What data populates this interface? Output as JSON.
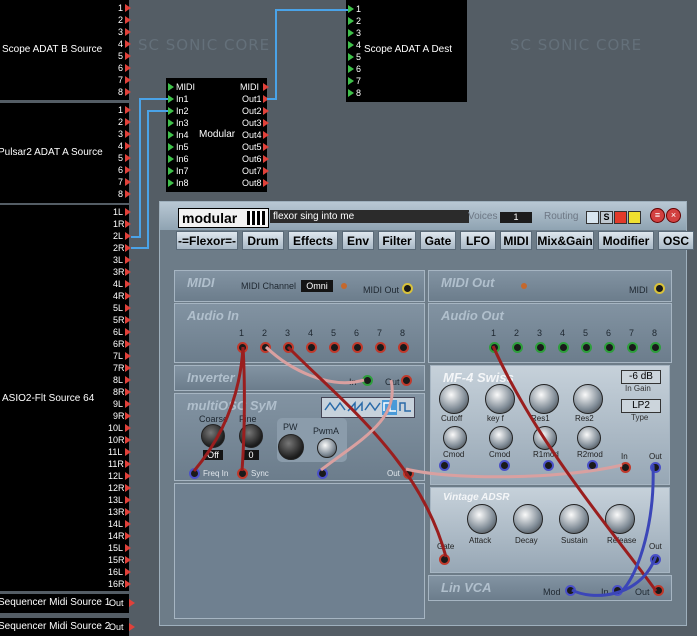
{
  "watermarks": [
    "SC SONIC CORE",
    "SC SONIC CORE"
  ],
  "nodes": {
    "adat_b_source": {
      "name": "Scope ADAT B Source",
      "ports": [
        "1",
        "2",
        "3",
        "4",
        "5",
        "6",
        "7",
        "8"
      ]
    },
    "pulsar_adat_a_source": {
      "name": "Pulsar2 ADAT A Source",
      "ports": [
        "1",
        "2",
        "3",
        "4",
        "5",
        "6",
        "7",
        "8"
      ]
    },
    "asio_source": {
      "name": "ASIO2-Flt Source 64",
      "ports": [
        "1L",
        "1R",
        "2L",
        "2R",
        "3L",
        "3R",
        "4L",
        "4R",
        "5L",
        "5R",
        "6L",
        "6R",
        "7L",
        "7R",
        "8L",
        "8R",
        "9L",
        "9R",
        "10L",
        "10R",
        "11L",
        "11R",
        "12L",
        "12R",
        "13L",
        "13R",
        "14L",
        "14R",
        "15L",
        "15R",
        "16L",
        "16R"
      ]
    },
    "seq_midi_1": {
      "name": "Sequencer Midi Source 1",
      "port": "Out"
    },
    "seq_midi_2": {
      "name": "Sequencer Midi Source 2",
      "port": "Out"
    },
    "adat_a_dest": {
      "name": "Scope ADAT A Dest",
      "ports": [
        "1",
        "2",
        "3",
        "4",
        "5",
        "6",
        "7",
        "8"
      ]
    },
    "modular": {
      "name": "Modular",
      "inputs": [
        "MIDI",
        "In1",
        "In2",
        "In3",
        "In4",
        "In5",
        "In6",
        "In7",
        "In8"
      ],
      "outputs": [
        "MIDI",
        "Out1",
        "Out2",
        "Out3",
        "Out4",
        "Out5",
        "Out6",
        "Out7",
        "Out8"
      ]
    }
  },
  "modular_window": {
    "logo": "modular",
    "preset_name": "flexor sing into me",
    "voices_label": "Voices",
    "voices_value": "1",
    "routing_label": "Routing",
    "routing_s": "S",
    "tabs": [
      "-=Flexor=-",
      "Drum",
      "Effects",
      "Env",
      "Filter",
      "Gate",
      "LFO",
      "MIDI",
      "Mix&Gain",
      "Modifier",
      "OSC"
    ],
    "midi_panel": {
      "title": "MIDI",
      "channel_label": "MIDI Channel",
      "channel_value": "Omni",
      "out_label": "MIDI Out"
    },
    "midi_out_panel": {
      "title": "MIDI Out",
      "midi_label": "MIDI"
    },
    "audio_in": {
      "title": "Audio In",
      "channels": [
        "1",
        "2",
        "3",
        "4",
        "5",
        "6",
        "7",
        "8"
      ]
    },
    "audio_out": {
      "title": "Audio Out",
      "channels": [
        "1",
        "2",
        "3",
        "4",
        "5",
        "6",
        "7",
        "8"
      ]
    },
    "inverter": {
      "title": "Inverter",
      "in_label": "In",
      "out_label": "Out"
    },
    "osc": {
      "title": "multiOSC SyM",
      "coarse_label": "Coarse",
      "fine_label": "Fine",
      "off_value": "Off",
      "fine_value": "0",
      "pw_label": "PW",
      "pwma_label": "PwmA",
      "freq_in_label": "Freq In",
      "sync_label": "Sync",
      "out_label": "Out"
    },
    "filter": {
      "title": "MF-4 Swiss",
      "gain_value": "-6 dB",
      "gain_label": "In Gain",
      "type_value": "LP2",
      "type_label": "Type",
      "knobs": [
        "Cutoff",
        "key f",
        "Res1",
        "Res2"
      ],
      "knobs2": [
        "Cmod",
        "Cmod",
        "R1mod",
        "R2mod"
      ],
      "in_label": "In",
      "out_label": "Out"
    },
    "adsr": {
      "title": "Vintage ADSR",
      "knobs": [
        "Attack",
        "Decay",
        "Sustain",
        "Release"
      ],
      "gate_label": "Gate",
      "out_label": "Out"
    },
    "vca": {
      "title": "Lin VCA",
      "mod_label": "Mod",
      "in_label": "In",
      "out_label": "Out"
    }
  }
}
